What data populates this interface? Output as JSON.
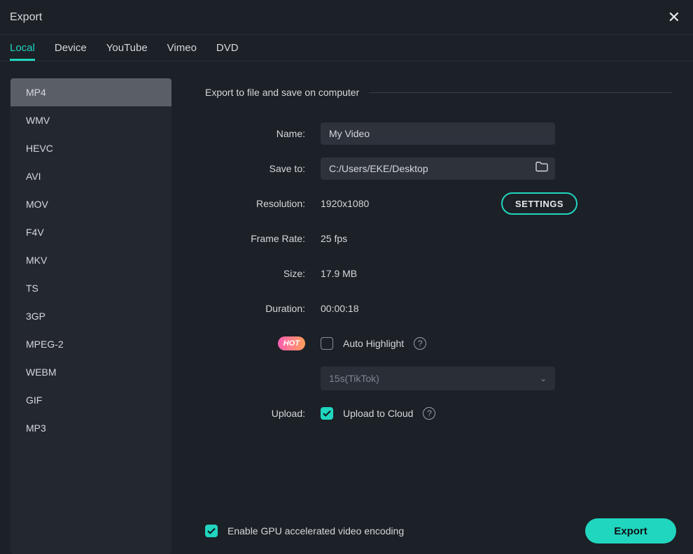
{
  "window": {
    "title": "Export"
  },
  "tabs": {
    "items": [
      "Local",
      "Device",
      "YouTube",
      "Vimeo",
      "DVD"
    ],
    "active": 0
  },
  "formats": {
    "items": [
      "MP4",
      "WMV",
      "HEVC",
      "AVI",
      "MOV",
      "F4V",
      "MKV",
      "TS",
      "3GP",
      "MPEG-2",
      "WEBM",
      "GIF",
      "MP3"
    ],
    "selected": 0
  },
  "section": {
    "title": "Export to file and save on computer"
  },
  "fields": {
    "name_label": "Name:",
    "name_value": "My Video",
    "saveto_label": "Save to:",
    "saveto_value": "C:/Users/EKE/Desktop",
    "resolution_label": "Resolution:",
    "resolution_value": "1920x1080",
    "settings_btn": "SETTINGS",
    "framerate_label": "Frame Rate:",
    "framerate_value": "25 fps",
    "size_label": "Size:",
    "size_value": "17.9 MB",
    "duration_label": "Duration:",
    "duration_value": "00:00:18",
    "hot_badge": "HOT",
    "autohighlight_label": "Auto Highlight",
    "autohighlight_checked": false,
    "preset_value": "15s(TikTok)",
    "upload_label": "Upload:",
    "uploadcloud_label": "Upload to Cloud",
    "uploadcloud_checked": true
  },
  "footer": {
    "gpu_label": "Enable GPU accelerated video encoding",
    "gpu_checked": true,
    "export_btn": "Export"
  }
}
